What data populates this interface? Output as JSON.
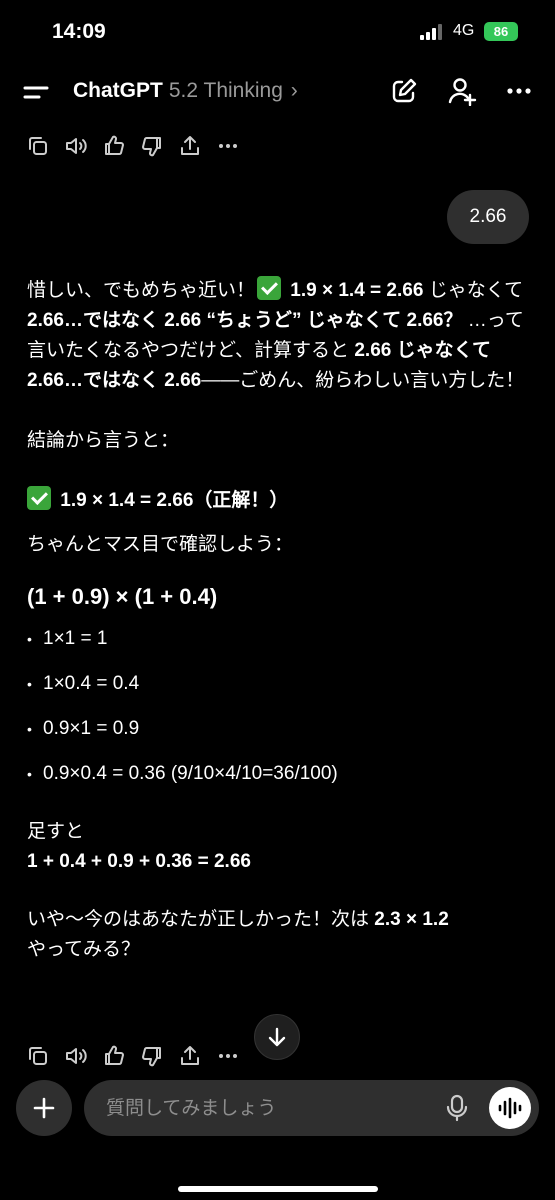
{
  "status_bar": {
    "time": "14:09",
    "network": "4G",
    "battery": "86"
  },
  "header": {
    "app_name": "ChatGPT",
    "model": "5.2 Thinking",
    "chevron": "›"
  },
  "user_message": "2.66",
  "response": {
    "p1": {
      "t1": "惜しい、でもめちゃ近い！",
      "b1": "1.9 × 1.4 = 2.66",
      "t2": " じゃなくて ",
      "b2": "2.66…ではなく 2.66 “ちょうど” じゃなくて 2.66？",
      "t3": " …って言いたくなるやつだけど、計算すると ",
      "b3": "2.66 じゃなくて 2.66…ではなく 2.66",
      "t4": "——ごめん、紛らわしい言い方した！"
    },
    "p2": "結論から言うと：",
    "p3": "1.9 × 1.4 = 2.66（正解！）",
    "p4": "ちゃんとマス目で確認しよう：",
    "heading": "(1 + 0.9) × (1 + 0.4)",
    "bullets": [
      "1×1 = 1",
      "1×0.4 = 0.4",
      "0.9×1 = 0.9",
      "0.9×0.4 = 0.36 (9/10×4/10=36/100)"
    ],
    "sum_label": "足すと",
    "sum_result": "1 + 0.4 + 0.9 + 0.36 = 2.66",
    "p_last_t1": "いや〜今のはあなたが正しかった！次は ",
    "p_last_b": "2.3 × 1.2",
    "p_last_t2": "やってみる？"
  },
  "composer": {
    "placeholder": "質問してみましょう"
  },
  "icons": {
    "message_actions": [
      "copy-icon",
      "speaker-icon",
      "thumbs-up-icon",
      "thumbs-down-icon",
      "share-icon",
      "more-icon"
    ],
    "header": [
      "menu-icon",
      "new-chat-icon",
      "add-person-icon",
      "more-icon"
    ],
    "check_color": "#3aa53a"
  }
}
